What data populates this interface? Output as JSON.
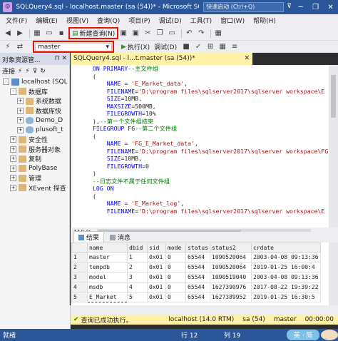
{
  "window": {
    "title": "SQLQuery4.sql - localhost.master (sa (54))* - Microsoft SQL Server",
    "quick_launch": "快速启动 (Ctrl+Q)",
    "buttons": [
      "─",
      "❐",
      "✕"
    ]
  },
  "menu": [
    "文件(F)",
    "编辑(E)",
    "视图(V)",
    "查询(Q)",
    "项目(P)",
    "调试(D)",
    "工具(T)",
    "窗口(W)",
    "帮助(H)"
  ],
  "toolbar": {
    "new_query_label": "新建查询(N)",
    "database": "master",
    "execute_label": "执行(X)",
    "debug_label": "调试(D)"
  },
  "object_explorer": {
    "title": "对象资源管...",
    "connect_label": "连接",
    "tree": [
      {
        "label": "localhost (SQL",
        "depth": 0,
        "expander": "-",
        "icon": "server"
      },
      {
        "label": "数据库",
        "depth": 1,
        "expander": "-",
        "icon": "folder"
      },
      {
        "label": "系统数据",
        "depth": 2,
        "expander": "+",
        "icon": "folder"
      },
      {
        "label": "数据库快",
        "depth": 2,
        "expander": "+",
        "icon": "folder"
      },
      {
        "label": "Demo_D",
        "depth": 2,
        "expander": "+",
        "icon": "db"
      },
      {
        "label": "plusoft_t",
        "depth": 2,
        "expander": "+",
        "icon": "db"
      },
      {
        "label": "安全性",
        "depth": 1,
        "expander": "+",
        "icon": "folder"
      },
      {
        "label": "服务器对象",
        "depth": 1,
        "expander": "+",
        "icon": "folder"
      },
      {
        "label": "复制",
        "depth": 1,
        "expander": "+",
        "icon": "folder"
      },
      {
        "label": "PolyBase",
        "depth": 1,
        "expander": "+",
        "icon": "folder"
      },
      {
        "label": "管理",
        "depth": 1,
        "expander": "+",
        "icon": "folder"
      },
      {
        "label": "XEvent 探查",
        "depth": 1,
        "expander": "+",
        "icon": "folder"
      }
    ]
  },
  "editor": {
    "tab_title": "SQLQuery4.sql - l...t.master (sa (54))*",
    "tab_close": "✕",
    "lines": [
      {
        "segs": [
          {
            "c": "kw",
            "t": "ON PRIMARY"
          },
          {
            "c": "cm",
            "t": "--主文件组"
          }
        ]
      },
      {
        "segs": [
          {
            "c": "",
            "t": "("
          }
        ]
      },
      {
        "segs": [
          {
            "c": "",
            "t": "    "
          },
          {
            "c": "kw",
            "t": "NAME"
          },
          {
            "c": "",
            "t": " = "
          },
          {
            "c": "str",
            "t": "'E_Market_data'"
          },
          {
            "c": "",
            "t": ","
          }
        ]
      },
      {
        "segs": [
          {
            "c": "",
            "t": "    "
          },
          {
            "c": "kw",
            "t": "FILENAME"
          },
          {
            "c": "",
            "t": "="
          },
          {
            "c": "str",
            "t": "'D:\\program files\\sqlserver2017\\sqlserver workspace\\E"
          }
        ]
      },
      {
        "segs": [
          {
            "c": "",
            "t": "    "
          },
          {
            "c": "kw",
            "t": "SIZE"
          },
          {
            "c": "",
            "t": "=10MB,"
          }
        ]
      },
      {
        "segs": [
          {
            "c": "",
            "t": "    "
          },
          {
            "c": "kw",
            "t": "MAXSIZE"
          },
          {
            "c": "",
            "t": "=500MB,"
          }
        ]
      },
      {
        "segs": [
          {
            "c": "",
            "t": "    "
          },
          {
            "c": "kw",
            "t": "FILEGROWTH"
          },
          {
            "c": "",
            "t": "=10%"
          }
        ]
      },
      {
        "segs": [
          {
            "c": "",
            "t": "),"
          },
          {
            "c": "cm",
            "t": "--第一个文件组结束"
          }
        ]
      },
      {
        "segs": [
          {
            "c": "kw",
            "t": "FILEGROUP"
          },
          {
            "c": "",
            "t": " FG"
          },
          {
            "c": "cm",
            "t": "--第二个文件组"
          }
        ]
      },
      {
        "segs": [
          {
            "c": "",
            "t": "("
          }
        ]
      },
      {
        "segs": [
          {
            "c": "",
            "t": "    "
          },
          {
            "c": "kw",
            "t": "NAME"
          },
          {
            "c": "",
            "t": " = "
          },
          {
            "c": "str",
            "t": "'FG_E_Market_data'"
          },
          {
            "c": "",
            "t": ","
          }
        ]
      },
      {
        "segs": [
          {
            "c": "",
            "t": "    "
          },
          {
            "c": "kw",
            "t": "FILENAME"
          },
          {
            "c": "",
            "t": "="
          },
          {
            "c": "str",
            "t": "'D:\\program files\\sqlserver2017\\sqlserver workspace\\FG"
          }
        ]
      },
      {
        "segs": [
          {
            "c": "",
            "t": "    "
          },
          {
            "c": "kw",
            "t": "SIZE"
          },
          {
            "c": "",
            "t": "=10MB,"
          }
        ]
      },
      {
        "segs": [
          {
            "c": "",
            "t": "    "
          },
          {
            "c": "kw",
            "t": "FILEGROWTH"
          },
          {
            "c": "",
            "t": "=0"
          }
        ]
      },
      {
        "segs": [
          {
            "c": "",
            "t": ")"
          }
        ]
      },
      {
        "segs": [
          {
            "c": "cm",
            "t": "--日志文件不属于任何文件组"
          }
        ]
      },
      {
        "segs": [
          {
            "c": "kw",
            "t": "LOG ON"
          }
        ]
      },
      {
        "segs": [
          {
            "c": "",
            "t": "("
          }
        ]
      },
      {
        "segs": [
          {
            "c": "",
            "t": "    "
          },
          {
            "c": "kw",
            "t": "NAME"
          },
          {
            "c": "",
            "t": " = "
          },
          {
            "c": "str",
            "t": "'E_Market_log'"
          },
          {
            "c": "",
            "t": ","
          }
        ]
      },
      {
        "segs": [
          {
            "c": "",
            "t": "    "
          },
          {
            "c": "kw",
            "t": "FILENAME"
          },
          {
            "c": "",
            "t": "="
          },
          {
            "c": "str",
            "t": "'D:\\program files\\sqlserver2017\\sqlserver workspace\\E"
          }
        ]
      }
    ]
  },
  "zoom": "110 %",
  "results": {
    "tabs": [
      "结果",
      "消息"
    ],
    "columns": [
      "",
      "name",
      "dbid",
      "sid",
      "mode",
      "status",
      "status2",
      "crdate"
    ],
    "rows": [
      [
        "1",
        "master",
        "1",
        "0x01",
        "0",
        "65544",
        "1090520064",
        "2003-04-08 09:13:36"
      ],
      [
        "2",
        "tempdb",
        "2",
        "0x01",
        "0",
        "65544",
        "1090520064",
        "2019-01-25 16:00:4"
      ],
      [
        "3",
        "model",
        "3",
        "0x01",
        "0",
        "65544",
        "1090519040",
        "2003-04-08 09:13:36"
      ],
      [
        "4",
        "msdb",
        "4",
        "0x01",
        "0",
        "65544",
        "1627390976",
        "2017-08-22 19:39:22"
      ],
      [
        "5",
        "E_Market",
        "5",
        "0x01",
        "0",
        "65544",
        "1627389952",
        "2019-01-25 16:30:5"
      ]
    ]
  },
  "query_status": {
    "message": "查询已成功执行。",
    "server": "localhost (14.0 RTM)",
    "user": "sa (54)",
    "database": "master",
    "time": "00:00:00"
  },
  "status_bar": {
    "ready": "就绪",
    "line": "行 12",
    "col": "列 19",
    "ime": "英 · 简"
  }
}
